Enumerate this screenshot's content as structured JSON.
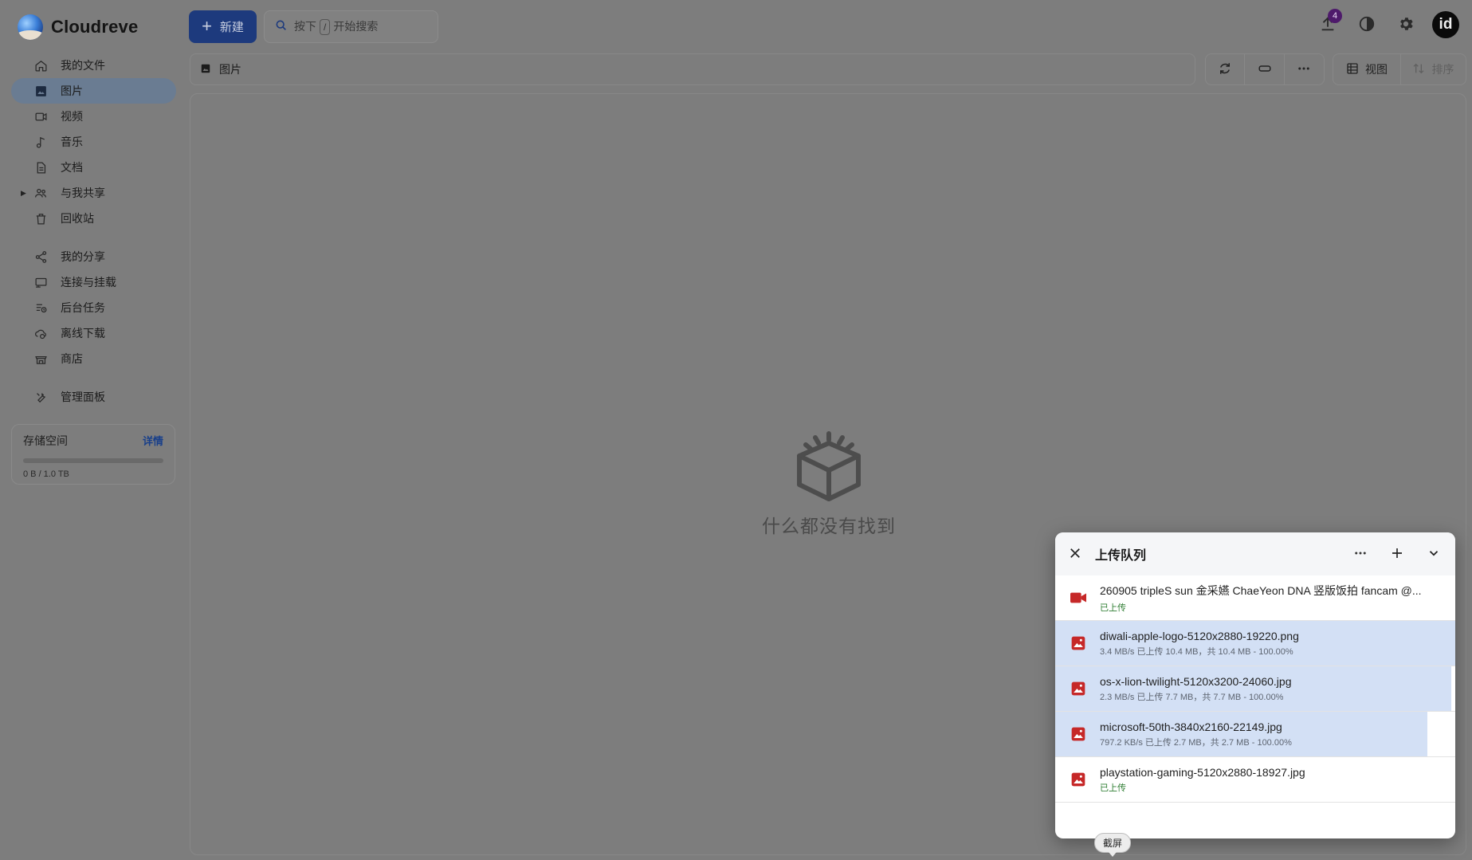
{
  "app": {
    "name": "Cloudreve"
  },
  "sidebar": {
    "items": [
      {
        "label": "我的文件",
        "icon": "home-icon"
      },
      {
        "label": "图片",
        "icon": "image-icon",
        "active": true
      },
      {
        "label": "视频",
        "icon": "video-icon"
      },
      {
        "label": "音乐",
        "icon": "music-icon"
      },
      {
        "label": "文档",
        "icon": "document-icon"
      },
      {
        "label": "与我共享",
        "icon": "shared-with-me-icon",
        "expandable": true
      },
      {
        "label": "回收站",
        "icon": "trash-icon"
      }
    ],
    "items2": [
      {
        "label": "我的分享",
        "icon": "share-icon"
      },
      {
        "label": "连接与挂载",
        "icon": "connect-icon"
      },
      {
        "label": "后台任务",
        "icon": "tasks-icon"
      },
      {
        "label": "离线下载",
        "icon": "cloud-download-icon"
      },
      {
        "label": "商店",
        "icon": "store-icon"
      }
    ],
    "items3": [
      {
        "label": "管理面板",
        "icon": "admin-icon"
      }
    ],
    "storage": {
      "title": "存储空间",
      "detail": "详情",
      "usage": "0 B / 1.0 TB",
      "fraction": 0
    }
  },
  "toolbar": {
    "new_label": "新建",
    "search": {
      "prefix": "按下",
      "key": "/",
      "suffix": "开始搜索"
    },
    "upload_badge": "4",
    "avatar_text": "id"
  },
  "breadcrumb": {
    "label": "图片"
  },
  "view_tools": {
    "view_label": "视图",
    "sort_label": "排序"
  },
  "empty_state": {
    "text": "什么都没有找到"
  },
  "upload_queue": {
    "title": "上传队列",
    "items": [
      {
        "name": "260905 tripleS sun 金采嬿 ChaeYeon DNA 竖版饭拍 fancam @...",
        "status": "已上传",
        "done": true,
        "type": "video-file-icon",
        "progress": 0
      },
      {
        "name": "diwali-apple-logo-5120x2880-19220.png",
        "status": "3.4 MB/s 已上传 10.4 MB，共 10.4 MB - 100.00%",
        "done": false,
        "type": "image-file-icon",
        "progress": 1.0
      },
      {
        "name": "os-x-lion-twilight-5120x3200-24060.jpg",
        "status": "2.3 MB/s 已上传 7.7 MB，共 7.7 MB - 100.00%",
        "done": false,
        "type": "image-file-icon",
        "progress": 0.99
      },
      {
        "name": "microsoft-50th-3840x2160-22149.jpg",
        "status": "797.2 KB/s 已上传 2.7 MB，共 2.7 MB - 100.00%",
        "done": false,
        "type": "image-file-icon",
        "progress": 0.93
      },
      {
        "name": "playstation-gaming-5120x2880-18927.jpg",
        "status": "已上传",
        "done": true,
        "type": "image-file-icon",
        "progress": 0
      }
    ]
  },
  "tooltip": {
    "text": "截屏"
  },
  "colors": {
    "accent": "#1d3a7d",
    "file_icon_red": "#c62828",
    "done_green": "#2e7d32",
    "progress_fill": "#d3e0f5"
  }
}
